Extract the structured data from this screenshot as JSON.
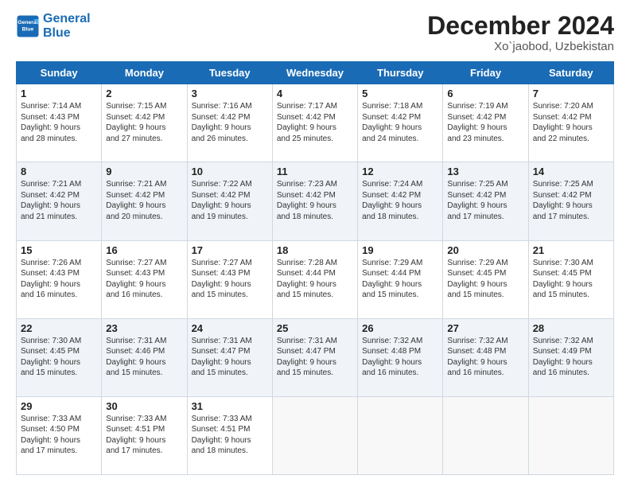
{
  "logo": {
    "line1": "General",
    "line2": "Blue"
  },
  "title": "December 2024",
  "location": "Xo`jaobod, Uzbekistan",
  "days_header": [
    "Sunday",
    "Monday",
    "Tuesday",
    "Wednesday",
    "Thursday",
    "Friday",
    "Saturday"
  ],
  "weeks": [
    [
      {
        "day": "1",
        "info": "Sunrise: 7:14 AM\nSunset: 4:43 PM\nDaylight: 9 hours\nand 28 minutes."
      },
      {
        "day": "2",
        "info": "Sunrise: 7:15 AM\nSunset: 4:42 PM\nDaylight: 9 hours\nand 27 minutes."
      },
      {
        "day": "3",
        "info": "Sunrise: 7:16 AM\nSunset: 4:42 PM\nDaylight: 9 hours\nand 26 minutes."
      },
      {
        "day": "4",
        "info": "Sunrise: 7:17 AM\nSunset: 4:42 PM\nDaylight: 9 hours\nand 25 minutes."
      },
      {
        "day": "5",
        "info": "Sunrise: 7:18 AM\nSunset: 4:42 PM\nDaylight: 9 hours\nand 24 minutes."
      },
      {
        "day": "6",
        "info": "Sunrise: 7:19 AM\nSunset: 4:42 PM\nDaylight: 9 hours\nand 23 minutes."
      },
      {
        "day": "7",
        "info": "Sunrise: 7:20 AM\nSunset: 4:42 PM\nDaylight: 9 hours\nand 22 minutes."
      }
    ],
    [
      {
        "day": "8",
        "info": "Sunrise: 7:21 AM\nSunset: 4:42 PM\nDaylight: 9 hours\nand 21 minutes."
      },
      {
        "day": "9",
        "info": "Sunrise: 7:21 AM\nSunset: 4:42 PM\nDaylight: 9 hours\nand 20 minutes."
      },
      {
        "day": "10",
        "info": "Sunrise: 7:22 AM\nSunset: 4:42 PM\nDaylight: 9 hours\nand 19 minutes."
      },
      {
        "day": "11",
        "info": "Sunrise: 7:23 AM\nSunset: 4:42 PM\nDaylight: 9 hours\nand 18 minutes."
      },
      {
        "day": "12",
        "info": "Sunrise: 7:24 AM\nSunset: 4:42 PM\nDaylight: 9 hours\nand 18 minutes."
      },
      {
        "day": "13",
        "info": "Sunrise: 7:25 AM\nSunset: 4:42 PM\nDaylight: 9 hours\nand 17 minutes."
      },
      {
        "day": "14",
        "info": "Sunrise: 7:25 AM\nSunset: 4:42 PM\nDaylight: 9 hours\nand 17 minutes."
      }
    ],
    [
      {
        "day": "15",
        "info": "Sunrise: 7:26 AM\nSunset: 4:43 PM\nDaylight: 9 hours\nand 16 minutes."
      },
      {
        "day": "16",
        "info": "Sunrise: 7:27 AM\nSunset: 4:43 PM\nDaylight: 9 hours\nand 16 minutes."
      },
      {
        "day": "17",
        "info": "Sunrise: 7:27 AM\nSunset: 4:43 PM\nDaylight: 9 hours\nand 15 minutes."
      },
      {
        "day": "18",
        "info": "Sunrise: 7:28 AM\nSunset: 4:44 PM\nDaylight: 9 hours\nand 15 minutes."
      },
      {
        "day": "19",
        "info": "Sunrise: 7:29 AM\nSunset: 4:44 PM\nDaylight: 9 hours\nand 15 minutes."
      },
      {
        "day": "20",
        "info": "Sunrise: 7:29 AM\nSunset: 4:45 PM\nDaylight: 9 hours\nand 15 minutes."
      },
      {
        "day": "21",
        "info": "Sunrise: 7:30 AM\nSunset: 4:45 PM\nDaylight: 9 hours\nand 15 minutes."
      }
    ],
    [
      {
        "day": "22",
        "info": "Sunrise: 7:30 AM\nSunset: 4:45 PM\nDaylight: 9 hours\nand 15 minutes."
      },
      {
        "day": "23",
        "info": "Sunrise: 7:31 AM\nSunset: 4:46 PM\nDaylight: 9 hours\nand 15 minutes."
      },
      {
        "day": "24",
        "info": "Sunrise: 7:31 AM\nSunset: 4:47 PM\nDaylight: 9 hours\nand 15 minutes."
      },
      {
        "day": "25",
        "info": "Sunrise: 7:31 AM\nSunset: 4:47 PM\nDaylight: 9 hours\nand 15 minutes."
      },
      {
        "day": "26",
        "info": "Sunrise: 7:32 AM\nSunset: 4:48 PM\nDaylight: 9 hours\nand 16 minutes."
      },
      {
        "day": "27",
        "info": "Sunrise: 7:32 AM\nSunset: 4:48 PM\nDaylight: 9 hours\nand 16 minutes."
      },
      {
        "day": "28",
        "info": "Sunrise: 7:32 AM\nSunset: 4:49 PM\nDaylight: 9 hours\nand 16 minutes."
      }
    ],
    [
      {
        "day": "29",
        "info": "Sunrise: 7:33 AM\nSunset: 4:50 PM\nDaylight: 9 hours\nand 17 minutes."
      },
      {
        "day": "30",
        "info": "Sunrise: 7:33 AM\nSunset: 4:51 PM\nDaylight: 9 hours\nand 17 minutes."
      },
      {
        "day": "31",
        "info": "Sunrise: 7:33 AM\nSunset: 4:51 PM\nDaylight: 9 hours\nand 18 minutes."
      },
      null,
      null,
      null,
      null
    ]
  ]
}
